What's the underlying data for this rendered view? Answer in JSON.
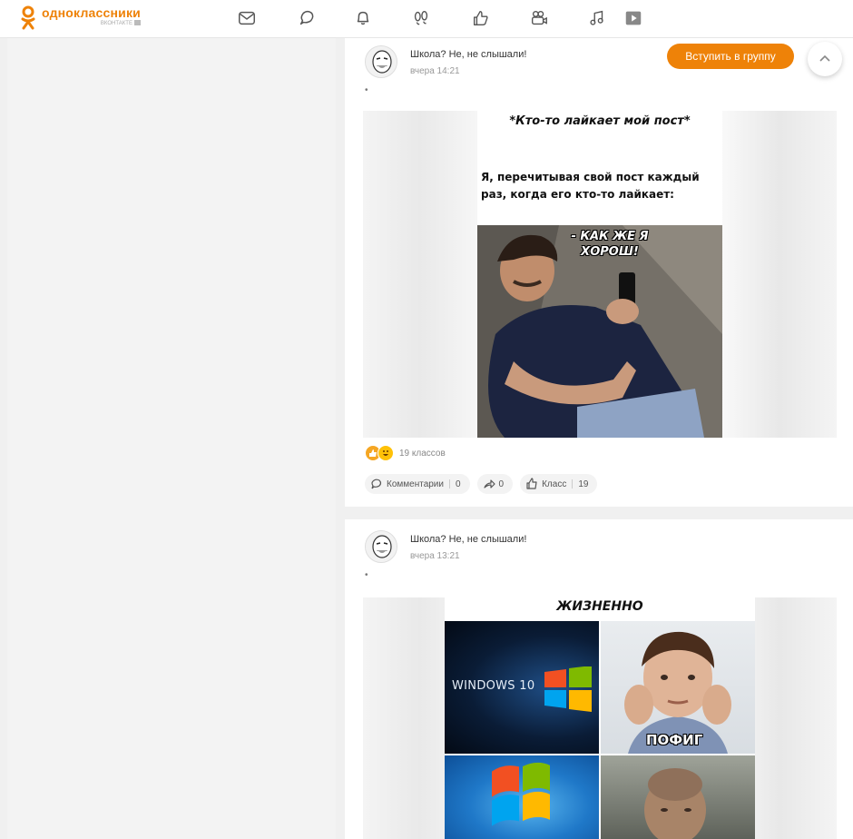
{
  "app": {
    "logo_name": "одноклассники",
    "logo_sub": "ВКОНТАКТЕ"
  },
  "nav": {
    "icons": [
      "mail-icon",
      "chat-icon",
      "bell-icon",
      "footprints-icon",
      "like-icon",
      "video-camera-icon",
      "music-icon",
      "games-icon"
    ]
  },
  "posts": [
    {
      "group": "Школа? Не, не слышали!",
      "time": "вчера 14:21",
      "dot": "•",
      "meme_top": "*Кто-то лайкает мой пост*",
      "meme_main": "Я, перечитывая свой пост каждый раз, когда его кто-то лайкает:",
      "meme_speech": "- КАК ЖЕ Я ХОРОШ!",
      "reaction_count": "19 классов",
      "comments_label": "Комментарии",
      "comments_count": "0",
      "shares_count": "0",
      "class_label": "Класс",
      "class_count": "19"
    },
    {
      "group": "Школа? Не, не слышали!",
      "time": "вчера 13:21",
      "dot": "•",
      "meme_head": "ЖИЗНЕННО",
      "win10_label": "WINDOWS 10",
      "pofig_label": "ПОФИГ"
    }
  ],
  "join_button": "Вступить в группу",
  "colors": {
    "accent": "#ee8208",
    "page_bg": "#f0f0f0"
  }
}
